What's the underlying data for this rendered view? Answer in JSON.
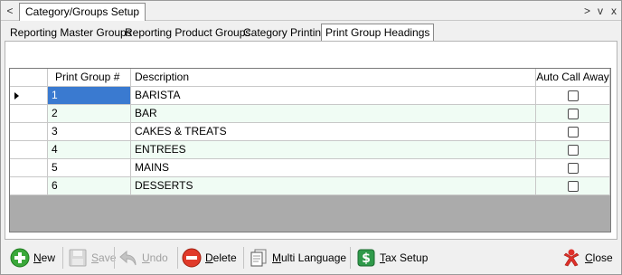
{
  "window": {
    "nav_left": "<",
    "title": "Category/Groups Setup",
    "nav_right": [
      ">",
      "v",
      "x"
    ]
  },
  "tabs": [
    {
      "label": "Reporting Master Groups",
      "active": false
    },
    {
      "label": "Reporting Product Groups",
      "active": false
    },
    {
      "label": "Category Printing",
      "active": false
    },
    {
      "label": "Print Group Headings",
      "active": true
    }
  ],
  "grid": {
    "columns": [
      "",
      "Print Group #",
      "Description",
      "Auto Call Away"
    ],
    "rows": [
      {
        "num": "1",
        "description": "BARISTA",
        "auto_call_away": false,
        "selected": true
      },
      {
        "num": "2",
        "description": "BAR",
        "auto_call_away": false,
        "selected": false
      },
      {
        "num": "3",
        "description": "CAKES & TREATS",
        "auto_call_away": false,
        "selected": false
      },
      {
        "num": "4",
        "description": "ENTREES",
        "auto_call_away": false,
        "selected": false
      },
      {
        "num": "5",
        "description": "MAINS",
        "auto_call_away": false,
        "selected": false
      },
      {
        "num": "6",
        "description": "DESSERTS",
        "auto_call_away": false,
        "selected": false
      }
    ]
  },
  "toolbar": {
    "new": {
      "u": "N",
      "rest": "ew",
      "enabled": true,
      "icon": "plus-circle-icon"
    },
    "save": {
      "u": "S",
      "rest": "ave",
      "enabled": false,
      "icon": "floppy-disk-icon"
    },
    "undo": {
      "u": "U",
      "rest": "ndo",
      "enabled": false,
      "icon": "undo-arrow-icon"
    },
    "delete": {
      "u": "D",
      "rest": "elete",
      "enabled": true,
      "icon": "minus-circle-icon"
    },
    "multi_language": {
      "u": "M",
      "rest": "ulti Language",
      "enabled": true,
      "icon": "document-pages-icon"
    },
    "tax_setup": {
      "u": "T",
      "rest": "ax Setup",
      "enabled": true,
      "icon": "dollar-icon"
    },
    "close": {
      "u": "C",
      "rest": "lose",
      "enabled": true,
      "icon": "close-person-icon"
    }
  }
}
